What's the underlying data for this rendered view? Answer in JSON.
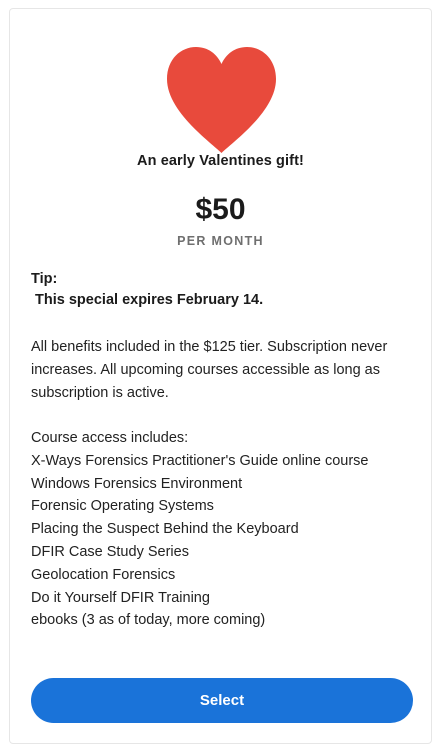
{
  "card": {
    "icon": "heart-icon",
    "icon_color": "#e84a3c",
    "title": "An early Valentines gift!",
    "price": "$50",
    "period": "PER MONTH",
    "tip_label": "Tip:",
    "tip_text": " This special expires February 14.",
    "description": "All benefits included in the $125 tier. Subscription never increases. All upcoming courses accessible as long as subscription is active.",
    "access_heading": "Course access includes:",
    "access_items": [
      "X-Ways Forensics Practitioner's Guide online course",
      "Windows Forensics Environment",
      "Forensic Operating Systems",
      "Placing the Suspect Behind the Keyboard",
      "DFIR Case Study Series",
      "Geolocation Forensics",
      "Do it Yourself DFIR Training",
      "ebooks (3 as of today, more coming)"
    ],
    "button_label": "Select",
    "button_color": "#1a73d9"
  }
}
